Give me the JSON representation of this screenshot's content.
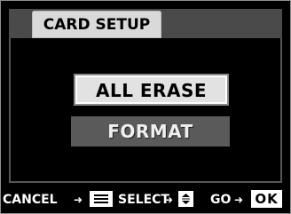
{
  "title": "CARD SETUP",
  "menu": {
    "items": [
      "ALL ERASE",
      "FORMAT"
    ],
    "selected_index": 0
  },
  "footer": {
    "cancel_label": "CANCEL",
    "select_label": "SELECT",
    "go_label": "GO",
    "ok_label": "OK",
    "menu_icon": "menu-list-icon",
    "updown_icon": "up-down-icon"
  },
  "colors": {
    "background": "#000000",
    "selected_item_bg": "#e2e2e2",
    "unselected_item_bg": "#5a5a5a",
    "tab_bg": "#d9d9d9"
  }
}
